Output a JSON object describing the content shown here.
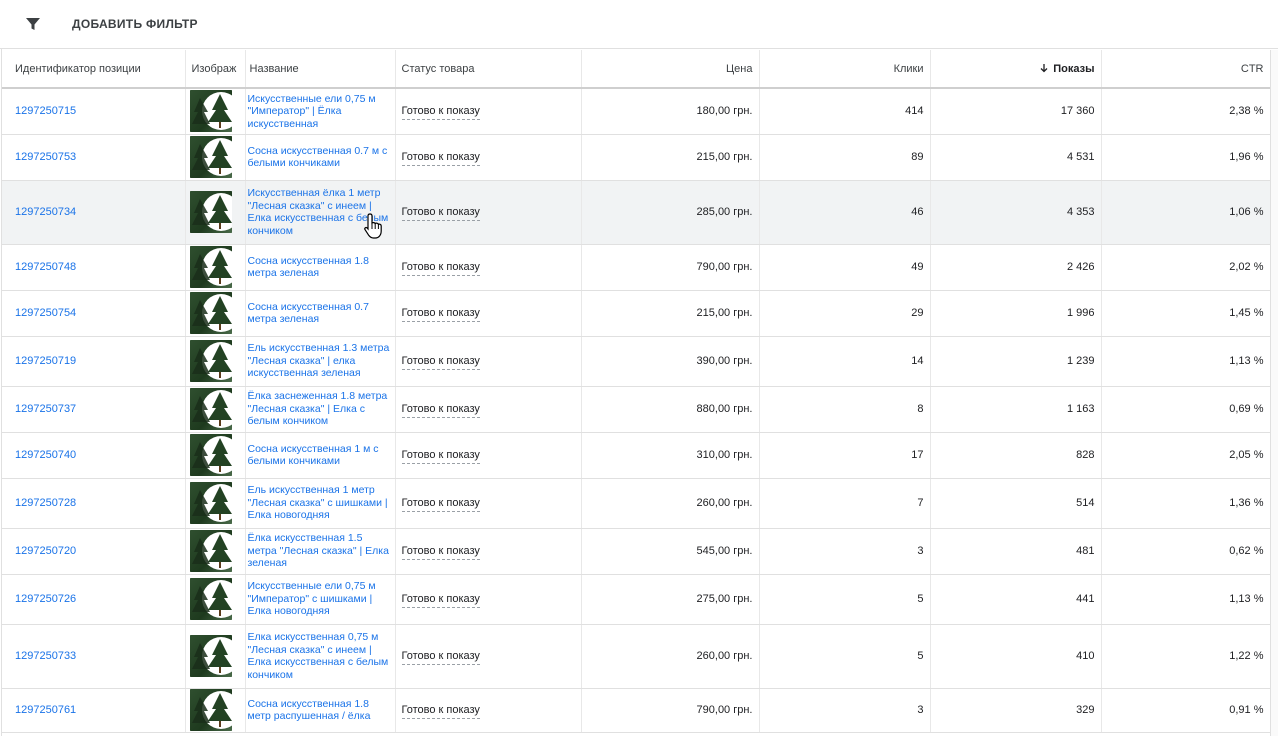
{
  "toolbar": {
    "filter_label": "ДОБАВИТЬ ФИЛЬТР",
    "filter_icon": "filter-icon"
  },
  "columns": {
    "id": "Идентификатор позиции",
    "image": "Изображ",
    "name": "Название",
    "status": "Статус товара",
    "price": "Цена",
    "clicks": "Клики",
    "impressions": "Показы",
    "ctr": "CTR",
    "sort_icon": "arrow-down-icon"
  },
  "rows": [
    {
      "id": "1297250715",
      "name": "Искусственные ели 0,75 м \"Император\" | Ёлка искусственная",
      "status": "Готово к показу",
      "price": "180,00 грн.",
      "clicks": "414",
      "impressions": "17 360",
      "ctr": "2,38 %"
    },
    {
      "id": "1297250753",
      "name": "Сосна искусственная 0.7 м с белыми кончиками",
      "status": "Готово к показу",
      "price": "215,00 грн.",
      "clicks": "89",
      "impressions": "4 531",
      "ctr": "1,96 %"
    },
    {
      "id": "1297250734",
      "name": "Искусственная ёлка 1 метр \"Лесная сказка\" с инеем | Елка искусственная с белым кончиком",
      "status": "Готово к показу",
      "price": "285,00 грн.",
      "clicks": "46",
      "impressions": "4 353",
      "ctr": "1,06 %"
    },
    {
      "id": "1297250748",
      "name": "Сосна искусственная 1.8 метра зеленая",
      "status": "Готово к показу",
      "price": "790,00 грн.",
      "clicks": "49",
      "impressions": "2 426",
      "ctr": "2,02 %"
    },
    {
      "id": "1297250754",
      "name": "Сосна искусственная 0.7 метра зеленая",
      "status": "Готово к показу",
      "price": "215,00 грн.",
      "clicks": "29",
      "impressions": "1 996",
      "ctr": "1,45 %"
    },
    {
      "id": "1297250719",
      "name": "Ель искусственная 1.3 метра \"Лесная сказка\" | елка искусственная зеленая",
      "status": "Готово к показу",
      "price": "390,00 грн.",
      "clicks": "14",
      "impressions": "1 239",
      "ctr": "1,13 %"
    },
    {
      "id": "1297250737",
      "name": "Ёлка заснеженная 1.8 метра \"Лесная сказка\" | Елка с белым кончиком",
      "status": "Готово к показу",
      "price": "880,00 грн.",
      "clicks": "8",
      "impressions": "1 163",
      "ctr": "0,69 %"
    },
    {
      "id": "1297250740",
      "name": "Сосна искусственная 1 м с белыми кончиками",
      "status": "Готово к показу",
      "price": "310,00 грн.",
      "clicks": "17",
      "impressions": "828",
      "ctr": "2,05 %"
    },
    {
      "id": "1297250728",
      "name": "Ель искусственная 1 метр \"Лесная сказка\" с шишками | Елка новогодняя",
      "status": "Готово к показу",
      "price": "260,00 грн.",
      "clicks": "7",
      "impressions": "514",
      "ctr": "1,36 %"
    },
    {
      "id": "1297250720",
      "name": "Ёлка искусственная 1.5 метра \"Лесная сказка\" | Елка зеленая",
      "status": "Готово к показу",
      "price": "545,00 грн.",
      "clicks": "3",
      "impressions": "481",
      "ctr": "0,62 %"
    },
    {
      "id": "1297250726",
      "name": "Искусственные ели 0,75 м \"Император\" с шишками | Елка новогодняя",
      "status": "Готово к показу",
      "price": "275,00 грн.",
      "clicks": "5",
      "impressions": "441",
      "ctr": "1,13 %"
    },
    {
      "id": "1297250733",
      "name": "Елка искусственная 0,75 м \"Лесная сказка\" с инеем | Елка искусственная с белым кончиком",
      "status": "Готово к показу",
      "price": "260,00 грн.",
      "clicks": "5",
      "impressions": "410",
      "ctr": "1,22 %"
    },
    {
      "id": "1297250761",
      "name": "Сосна искусственная 1.8 метр распушенная / ёлка",
      "status": "Готово к показу",
      "price": "790,00 грн.",
      "clicks": "3",
      "impressions": "329",
      "ctr": "0,91 %"
    }
  ],
  "hovered_row": 2,
  "colors": {
    "link": "#1a73e8",
    "hover_row": "#f1f3f4"
  }
}
